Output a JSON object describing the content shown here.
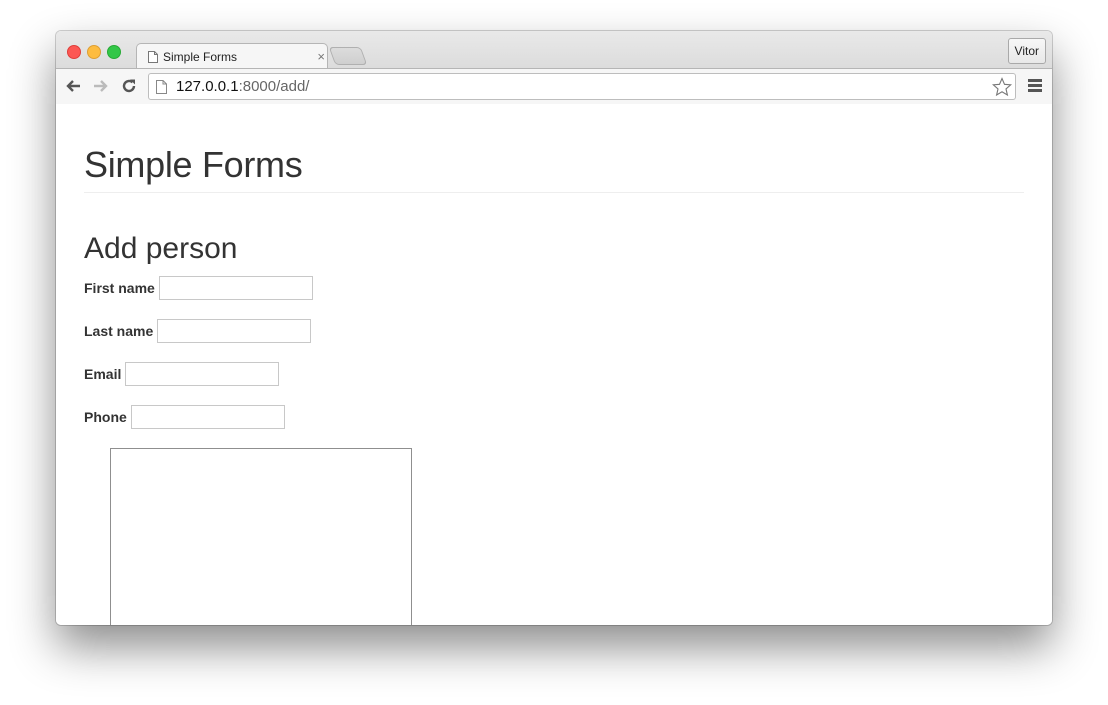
{
  "browser": {
    "tab": {
      "title": "Simple Forms",
      "icon": "page-icon",
      "close_label": "×"
    },
    "profile_label": "Vitor",
    "url": {
      "host": "127.0.0.1",
      "rest": ":8000/add/"
    },
    "icons": {
      "back": "arrow-left-icon",
      "forward": "arrow-right-icon",
      "reload": "reload-icon",
      "bookmark": "star-icon",
      "menu": "hamburger-menu-icon"
    }
  },
  "page": {
    "title": "Simple Forms",
    "section_title": "Add person",
    "form": {
      "fields": [
        {
          "label": "First name",
          "value": "",
          "placeholder": ""
        },
        {
          "label": "Last name",
          "value": "",
          "placeholder": ""
        },
        {
          "label": "Email",
          "value": "",
          "placeholder": ""
        },
        {
          "label": "Phone",
          "value": "",
          "placeholder": ""
        }
      ],
      "textarea_value": ""
    }
  }
}
